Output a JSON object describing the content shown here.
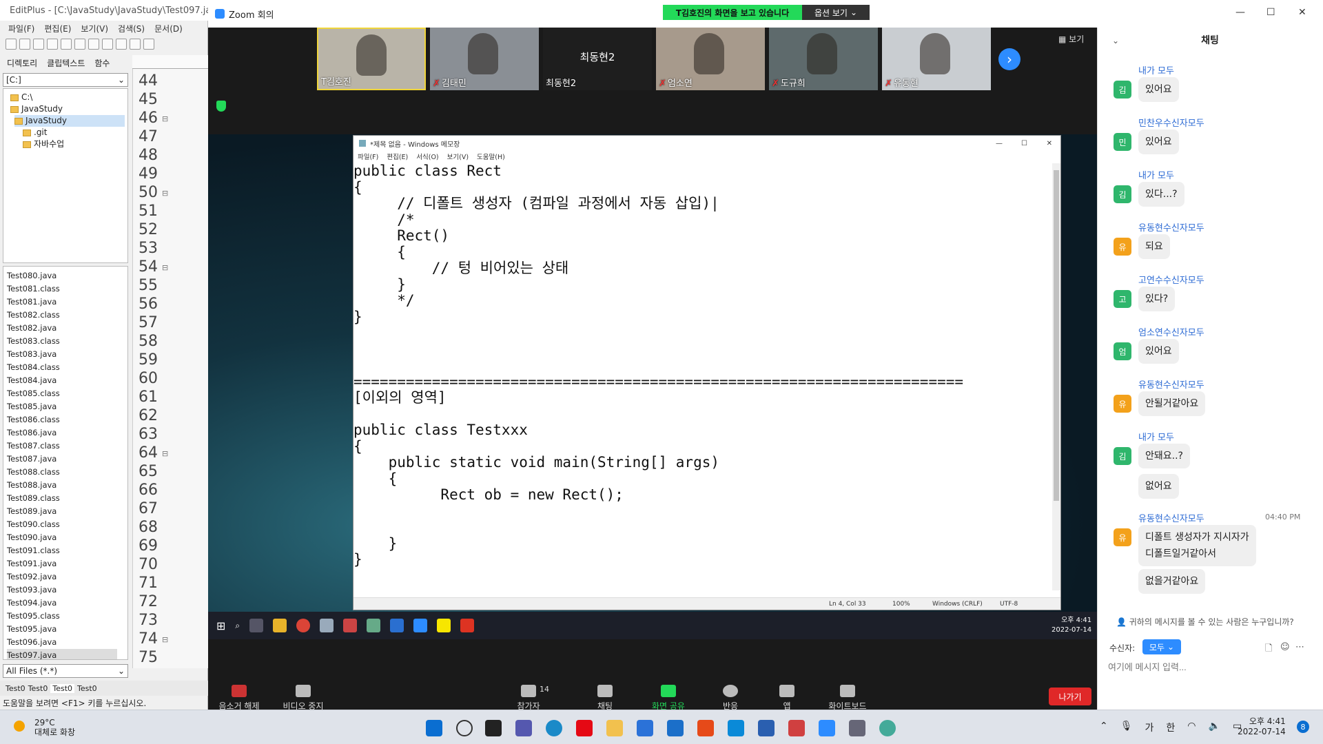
{
  "editplus": {
    "title": "EditPlus - [C:\\JavaStudy\\JavaStudy\\Test097.java",
    "menu": [
      "파일(F)",
      "편집(E)",
      "보기(V)",
      "검색(S)",
      "문서(D)"
    ],
    "panel_tabs": [
      "디렉토리",
      "클립텍스트",
      "함수"
    ],
    "drive": "[C:]",
    "tree": [
      "C:\\",
      "JavaStudy",
      "JavaStudy",
      ".git",
      "자바수업"
    ],
    "files": [
      "Test080.java",
      "Test081.class",
      "Test081.java",
      "Test082.class",
      "Test082.java",
      "Test083.class",
      "Test083.java",
      "Test084.class",
      "Test084.java",
      "Test085.class",
      "Test085.java",
      "Test086.class",
      "Test086.java",
      "Test087.class",
      "Test087.java",
      "Test088.class",
      "Test088.java",
      "Test089.class",
      "Test089.java",
      "Test090.class",
      "Test090.java",
      "Test091.class",
      "Test091.java",
      "Test092.java",
      "Test093.java",
      "Test094.java",
      "Test095.class",
      "Test095.java",
      "Test096.java",
      "Test097.java"
    ],
    "filter": "All Files (*.*)",
    "line_numbers": [
      "44",
      "45",
      "46",
      "47",
      "48",
      "49",
      "50",
      "51",
      "52",
      "53",
      "54",
      "55",
      "56",
      "57",
      "58",
      "59",
      "60",
      "61",
      "62",
      "63",
      "64",
      "65",
      "66",
      "67",
      "68",
      "69",
      "70",
      "71",
      "72",
      "73",
      "74",
      "75"
    ],
    "fold_marker": "⊟",
    "doc_tabs": [
      "Test0",
      "Test0",
      "Test0",
      "Test0"
    ],
    "status": "도움말을 보려면 <F1> 키를 누르십시오."
  },
  "zoom": {
    "title": "Zoom 회의",
    "share_banner": "T김호진의 화면을 보고 있습니다",
    "view_options": "옵션 보기",
    "view_label": "보기",
    "participants": [
      {
        "name": "T김호진",
        "muted": false,
        "bg": "#b9b4a8"
      },
      {
        "name": "김태민",
        "muted": true,
        "bg": "#8a8f95"
      },
      {
        "name": "최동현2",
        "muted": false,
        "bg": "#1e1e1e",
        "center_name": "최동현2"
      },
      {
        "name": "엄소연",
        "muted": true,
        "bg": "#a79a8c"
      },
      {
        "name": "도규희",
        "muted": true,
        "bg": "#5e6a6c"
      },
      {
        "name": "유동현",
        "muted": true,
        "bg": "#c9cdd1"
      }
    ],
    "controls": [
      {
        "label": "음소거 해제"
      },
      {
        "label": "비디오 중지"
      },
      {
        "label": "참가자",
        "count": "14"
      },
      {
        "label": "채팅"
      },
      {
        "label": "화면 공유"
      },
      {
        "label": "반응"
      },
      {
        "label": "앱"
      },
      {
        "label": "화이트보드"
      }
    ],
    "leave": "나가기"
  },
  "notepad": {
    "title": "*제목 없음 - Windows 메모장",
    "menu": [
      "파일(F)",
      "편집(E)",
      "서식(O)",
      "보기(V)",
      "도움말(H)"
    ],
    "text": "public class Rect\n{\n     // 디폴트 생성자 (컴파일 과정에서 자동 삽입)|\n     /*\n     Rect()\n     {\n         // 텅 비어있는 상태\n     }\n     */\n}\n\n\n\n======================================================================\n[이외의 영역]\n\npublic class Testxxx\n{\n    public static void main(String[] args)\n    {\n          Rect ob = new Rect();\n\n\n    }\n}",
    "status": {
      "pos": "Ln 4, Col 33",
      "zoom": "100%",
      "eol": "Windows (CRLF)",
      "enc": "UTF-8"
    }
  },
  "shared_taskbar": {
    "time": "오후 4:41",
    "date": "2022-07-14"
  },
  "chat": {
    "title": "채팅",
    "messages": [
      {
        "sender": "내가 모두",
        "avatar": "김",
        "color": "#2fb66c",
        "text": "있어요"
      },
      {
        "sender": "민찬우수신자모두",
        "avatar": "민",
        "color": "#2fb66c",
        "text": "있어요"
      },
      {
        "sender": "내가 모두",
        "avatar": "김",
        "color": "#2fb66c",
        "text": "있다...?"
      },
      {
        "sender": "유동현수신자모두",
        "avatar": "유",
        "color": "#f3a11b",
        "text": "되요"
      },
      {
        "sender": "고연수수신자모두",
        "avatar": "고",
        "color": "#2fb66c",
        "text": "있다?"
      },
      {
        "sender": "엄소연수신자모두",
        "avatar": "엄",
        "color": "#2fb66c",
        "text": "있어요"
      },
      {
        "sender": "유동현수신자모두",
        "avatar": "유",
        "color": "#f3a11b",
        "text": "안될거같아요"
      },
      {
        "sender": "내가 모두",
        "avatar": "김",
        "color": "#2fb66c",
        "text": "안돼요..?",
        "extra": "없어요"
      },
      {
        "sender": "유동현수신자모두",
        "avatar": "유",
        "color": "#f3a11b",
        "time": "04:40 PM",
        "text": "디폴트 생성자가 지시자가\n디폴트일거같아서",
        "extra": "없을거같아요"
      }
    ],
    "who_can_see": "귀하의 메시지를 볼 수 있는 사람은 누구입니까?",
    "to_label": "수신자:",
    "to_value": "모두",
    "input_placeholder": "여기에 메시지 입력..."
  },
  "taskbar": {
    "temp": "29°C",
    "weather": "대체로 화창",
    "time": "오후 4:41",
    "date": "2022-07-14",
    "ime": "가",
    "ime2": "한",
    "notif": "8"
  }
}
